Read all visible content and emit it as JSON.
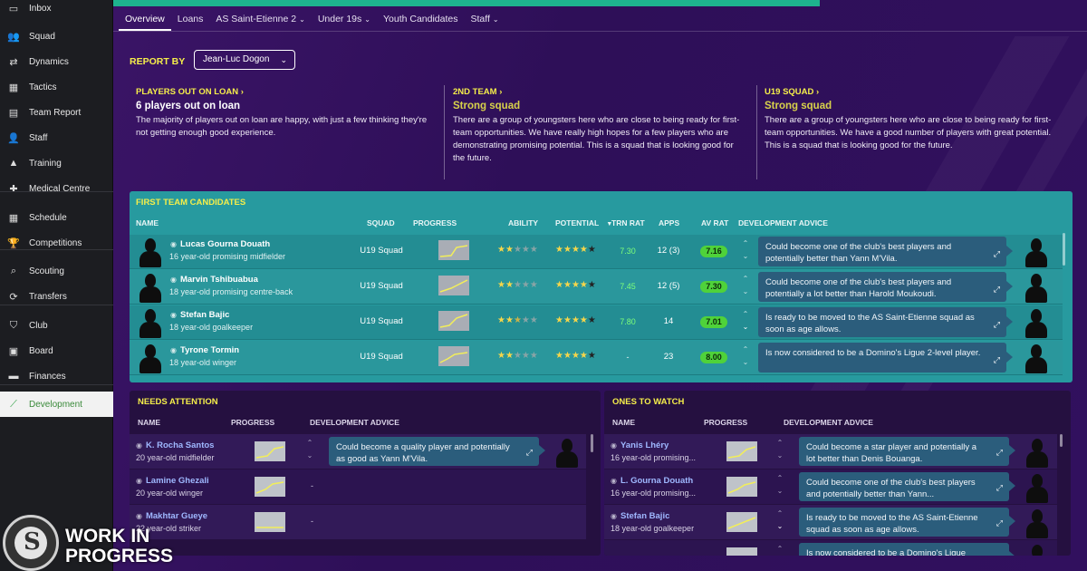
{
  "sidebar": {
    "items": [
      {
        "label": "Inbox",
        "icon": "inbox-icon"
      },
      {
        "label": "Squad",
        "icon": "squad-icon"
      },
      {
        "label": "Dynamics",
        "icon": "dynamics-icon"
      },
      {
        "label": "Tactics",
        "icon": "tactics-icon"
      },
      {
        "label": "Team Report",
        "icon": "team-report-icon"
      },
      {
        "label": "Staff",
        "icon": "staff-icon"
      },
      {
        "label": "Training",
        "icon": "training-icon"
      },
      {
        "label": "Medical Centre",
        "icon": "medical-icon"
      },
      {
        "label": "Schedule",
        "icon": "calendar-icon"
      },
      {
        "label": "Competitions",
        "icon": "trophy-icon"
      },
      {
        "label": "Scouting",
        "icon": "search-icon"
      },
      {
        "label": "Transfers",
        "icon": "transfer-icon"
      },
      {
        "label": "Club",
        "icon": "shield-icon"
      },
      {
        "label": "Board",
        "icon": "briefcase-icon"
      },
      {
        "label": "Finances",
        "icon": "money-icon"
      },
      {
        "label": "Development",
        "icon": "development-icon",
        "active": true
      }
    ]
  },
  "tabs": [
    {
      "label": "Overview",
      "active": true
    },
    {
      "label": "Loans"
    },
    {
      "label": "AS Saint-Etienne 2",
      "dropdown": true
    },
    {
      "label": "Under 19s",
      "dropdown": true
    },
    {
      "label": "Youth Candidates"
    },
    {
      "label": "Staff",
      "dropdown": true
    }
  ],
  "report": {
    "label": "REPORT BY",
    "selected": "Jean-Luc Dogon"
  },
  "summaries": [
    {
      "heading": "PLAYERS OUT ON LOAN",
      "headline": "6 players out on loan",
      "headline_color": "white",
      "text": "The majority of players out on loan are happy, with just a few thinking they're not getting enough good experience."
    },
    {
      "heading": "2ND TEAM",
      "headline": "Strong squad",
      "headline_color": "yellow",
      "text": "There are a group of youngsters here who are close to being ready for first-team opportunities. We have really high hopes for a few players who are demonstrating promising potential. This is a squad that is looking good for the future."
    },
    {
      "heading": "U19 SQUAD",
      "headline": "Strong squad",
      "headline_color": "yellow",
      "text": "There are a group of youngsters here who are close to being ready for first-team opportunities. We have a good number of players with great potential. This is a squad that is looking good for the future."
    }
  ],
  "first_team": {
    "title": "FIRST TEAM CANDIDATES",
    "columns": {
      "name": "NAME",
      "squad": "SQUAD",
      "progress": "PROGRESS",
      "ability": "ABILITY",
      "potential": "POTENTIAL",
      "trn": "TRN RAT",
      "apps": "APPS",
      "av": "AV RAT",
      "advice": "DEVELOPMENT ADVICE"
    },
    "rows": [
      {
        "name": "Lucas Gourna Douath",
        "desc": "16 year-old promising midfielder",
        "squad": "U19 Squad",
        "ability": 2,
        "potential": 5,
        "trn": "7.30",
        "apps": "12 (3)",
        "av": "7.16",
        "advice": "Could become one of the club's best players and potentially better than Yann M'Vila."
      },
      {
        "name": "Marvin Tshibuabua",
        "desc": "18 year-old promising centre-back",
        "squad": "U19 Squad",
        "ability": 2,
        "potential": 5,
        "trn": "7.45",
        "apps": "12 (5)",
        "av": "7.30",
        "advice": "Could become one of the club's best players and potentially a lot better than Harold Moukoudi."
      },
      {
        "name": "Stefan Bajic",
        "desc": "18 year-old goalkeeper",
        "squad": "U19 Squad",
        "ability": 2.5,
        "potential": 5,
        "trn": "7.80",
        "apps": "14",
        "av": "7.01",
        "advice": "Is ready to be moved to the AS Saint-Etienne squad as soon as age allows."
      },
      {
        "name": "Tyrone Tormin",
        "desc": "18 year-old winger",
        "squad": "U19 Squad",
        "ability": 2,
        "potential": 5,
        "trn": "-",
        "apps": "23",
        "av": "8.00",
        "advice": "Is now considered to be a Domino's Ligue 2-level player."
      }
    ]
  },
  "needs_attention": {
    "title": "NEEDS ATTENTION",
    "columns": {
      "name": "NAME",
      "progress": "PROGRESS",
      "advice": "DEVELOPMENT ADVICE"
    },
    "rows": [
      {
        "name": "K. Rocha Santos",
        "desc": "20 year-old midfielder",
        "advice": "Could become a quality player and potentially as good as Yann M'Vila."
      },
      {
        "name": "Lamine Ghezali",
        "desc": "20 year-old winger",
        "advice": "-"
      },
      {
        "name": "Makhtar Gueye",
        "desc": "22 year-old striker",
        "advice": "-"
      }
    ]
  },
  "ones_to_watch": {
    "title": "ONES TO WATCH",
    "columns": {
      "name": "NAME",
      "progress": "PROGRESS",
      "advice": "DEVELOPMENT ADVICE"
    },
    "rows": [
      {
        "name": "Yanis Lhéry",
        "desc": "16 year-old promising...",
        "advice": "Could become a star player and potentially a lot better than Denis Bouanga."
      },
      {
        "name": "L. Gourna Douath",
        "desc": "16 year-old promising...",
        "advice": "Could become one of the club's best players and potentially better than Yann..."
      },
      {
        "name": "Stefan Bajic",
        "desc": "18 year-old goalkeeper",
        "advice": "Is ready to be moved to the AS Saint-Etienne squad as soon as age allows."
      },
      {
        "name": "",
        "desc": "",
        "advice": "Is now considered to be a Domino's Ligue"
      }
    ]
  },
  "watermark": {
    "line1": "WORK IN",
    "line2": "PROGRESS",
    "logo_text": "SPORTS INTERACTIVE"
  },
  "colors": {
    "accent": "#1eb38e",
    "yellow": "#f5ee4a",
    "teal_panel": "#279a9f",
    "rating_green": "#4fd23a",
    "advice_bg": "#2b5d7c"
  }
}
